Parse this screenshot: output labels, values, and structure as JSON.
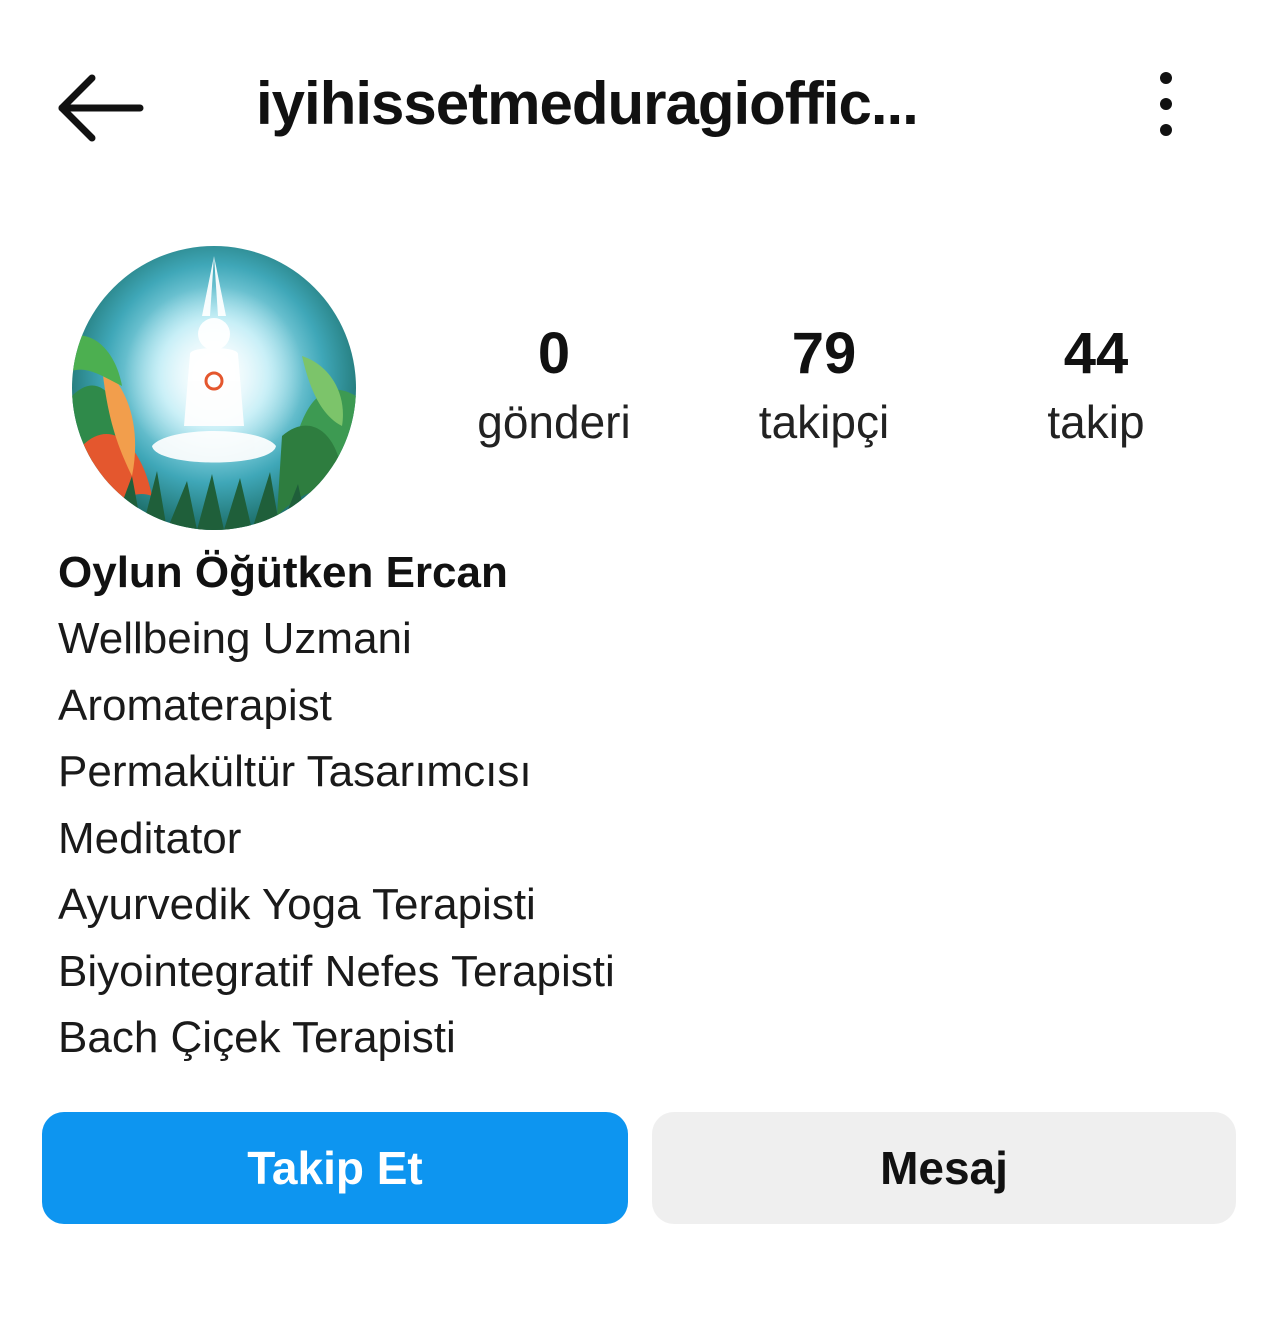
{
  "header": {
    "back_icon": "arrow-left-icon",
    "username": "iyihissetmeduragioffic...",
    "more_icon": "more-vertical-icon"
  },
  "profile": {
    "avatar_icon": "profile-avatar-meditation-image",
    "stats": {
      "posts": {
        "value": "0",
        "label": "gönderi"
      },
      "followers": {
        "value": "79",
        "label": "takipçi"
      },
      "following": {
        "value": "44",
        "label": "takip"
      }
    },
    "name": "Oylun Öğütken Ercan",
    "bio_lines": [
      "Wellbeing Uzmani",
      "Aromaterapist",
      "Permakültür Tasarımcısı",
      "Meditator",
      "Ayurvedik Yoga Terapisti",
      "Biyointegratif Nefes Terapisti",
      "Bach Çiçek Terapisti"
    ]
  },
  "actions": {
    "follow_label": "Takip Et",
    "message_label": "Mesaj"
  },
  "colors": {
    "follow_button_bg": "#0d95f0",
    "message_button_bg": "#efefef",
    "text": "#111111"
  }
}
